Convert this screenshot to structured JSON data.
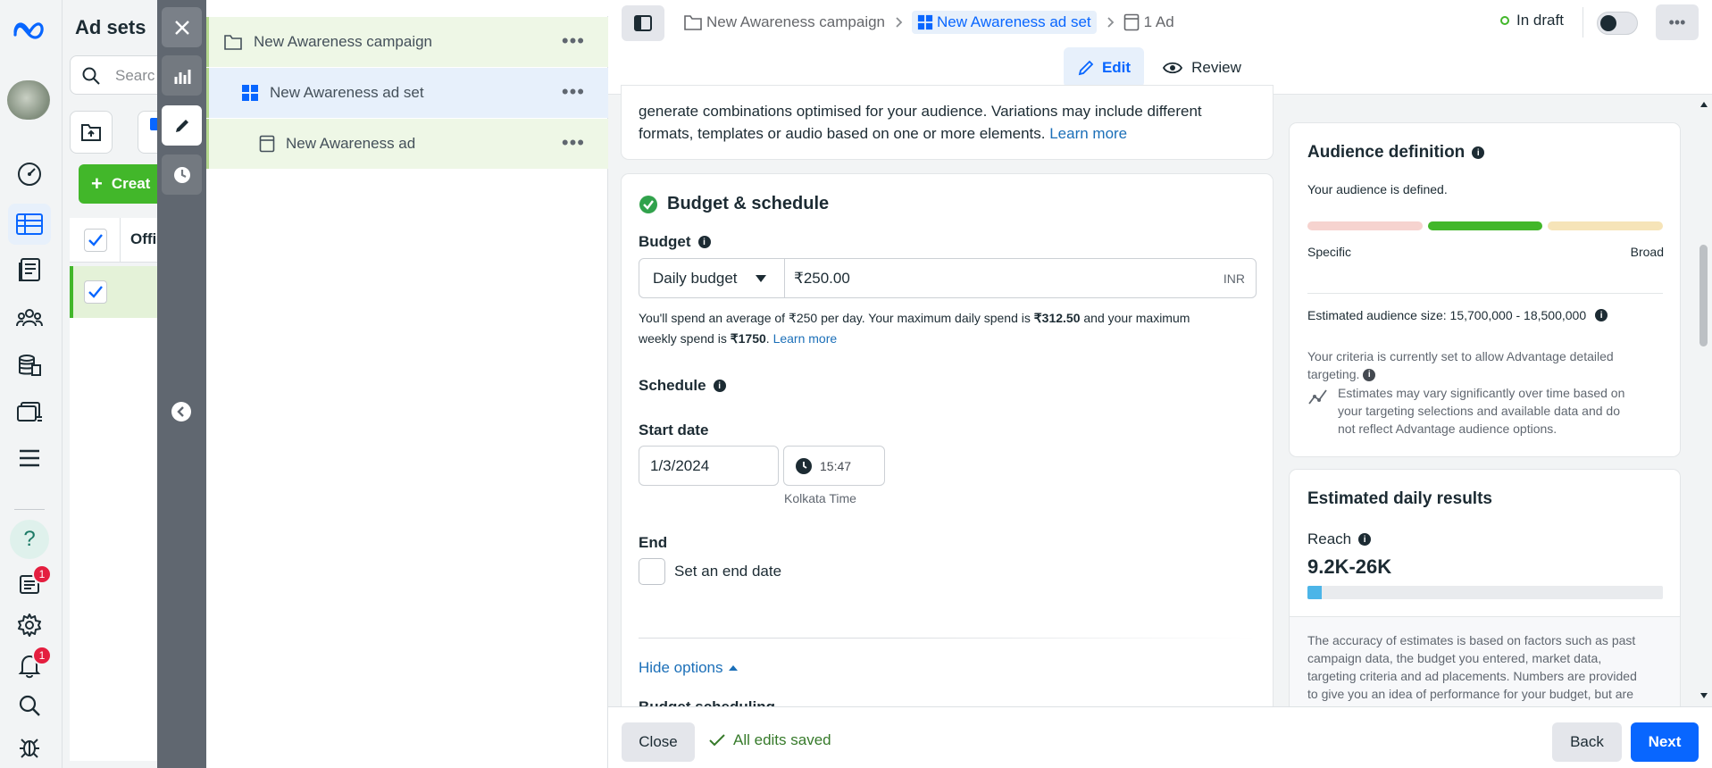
{
  "adsets_panel": {
    "title": "Ad sets",
    "search_placeholder": "Searc",
    "create_label": "Creat",
    "column_header": "Offi"
  },
  "tree": {
    "campaign": "New Awareness campaign",
    "adset": "New Awareness ad set",
    "ad": "New Awareness ad"
  },
  "header": {
    "breadcrumb_campaign": "New Awareness campaign",
    "breadcrumb_adset": "New Awareness ad set",
    "breadcrumb_ad": "1 Ad",
    "status": "In draft",
    "tab_edit": "Edit",
    "tab_review": "Review"
  },
  "creative_note": {
    "line1": "generate combinations optimised for your audience. Variations may include different",
    "line2": "formats, templates or audio based on one or more elements.",
    "learn_more": "Learn more"
  },
  "budget": {
    "section_title": "Budget & schedule",
    "budget_label": "Budget",
    "budget_type": "Daily budget",
    "amount": "₹250.00",
    "currency": "INR",
    "spend_text_1": "You'll spend an average of ₹250 per day. Your maximum daily spend is ",
    "max_daily": "₹312.50",
    "spend_text_2": " and your maximum",
    "spend_text_3": "weekly spend is ",
    "max_weekly": "₹1750",
    "spend_text_4": ". ",
    "learn_more": "Learn more",
    "schedule_label": "Schedule",
    "start_date_label": "Start date",
    "start_date": "1/3/2024",
    "start_time": "15:47",
    "timezone": "Kolkata Time",
    "end_label": "End",
    "end_checkbox_label": "Set an end date",
    "hide_options": "Hide options",
    "budget_scheduling_partial": "Budget scheduling"
  },
  "audience": {
    "title": "Audience definition",
    "status": "Your audience is defined.",
    "specific": "Specific",
    "broad": "Broad",
    "size_label": "Estimated audience size:",
    "size_value": "15,700,000 - 18,500,000",
    "criteria_1": "Your criteria is currently set to allow Advantage detailed",
    "criteria_2": "targeting.",
    "estimates_1": "Estimates may vary significantly over time based on",
    "estimates_2": "your targeting selections and available data and do",
    "estimates_3": "not reflect Advantage audience options."
  },
  "daily_results": {
    "title": "Estimated daily results",
    "reach_label": "Reach",
    "reach_value": "9.2K-26K",
    "reach_fill_fraction": 0.04,
    "accuracy_1": "The accuracy of estimates is based on factors such as past",
    "accuracy_2": "campaign data, the budget you entered, market data,",
    "accuracy_3": "targeting criteria and ad placements. Numbers are provided",
    "accuracy_4": "to give you an idea of performance for your budget, but are"
  },
  "footer": {
    "close": "Close",
    "saved": "All edits saved",
    "back": "Back",
    "next": "Next"
  },
  "badges": {
    "notifications_a": "1",
    "notifications_b": "1"
  },
  "colors": {
    "accent": "#1877f2",
    "green": "#42b72a",
    "draft_dot": "#42b72a"
  }
}
